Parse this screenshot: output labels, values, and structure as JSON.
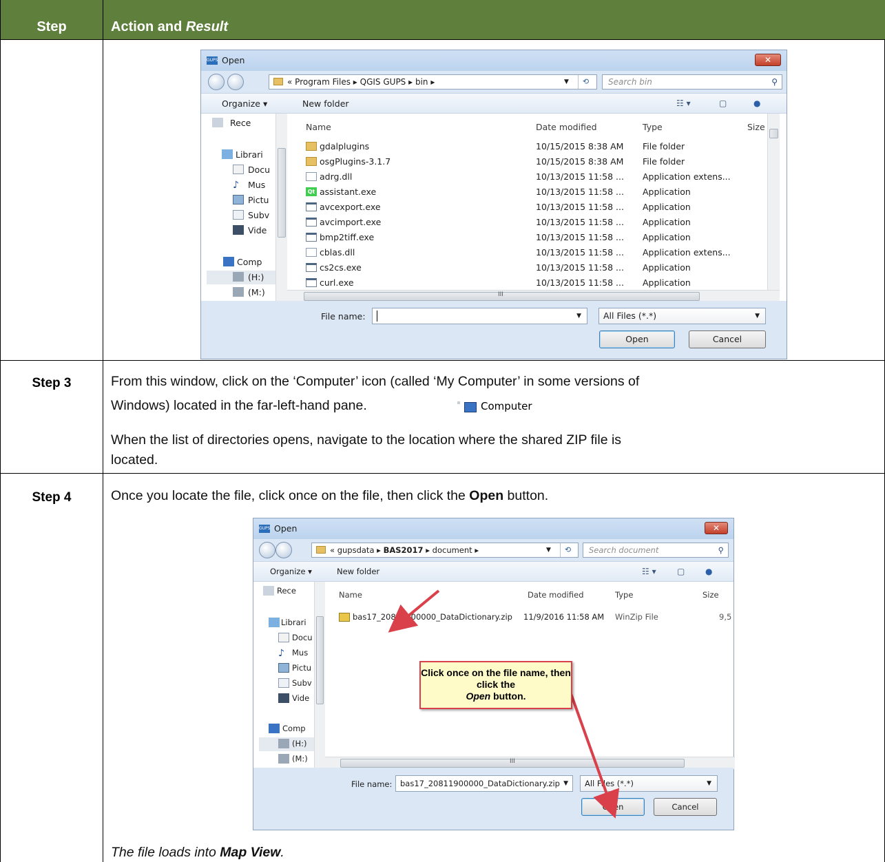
{
  "header": {
    "step_col": "Step",
    "action_col": "Action and ",
    "result_word": "Result"
  },
  "dialog1": {
    "title": "Open",
    "close_glyph": "✕",
    "address": {
      "chevrons": "«",
      "crumbs": [
        "Program Files",
        "QGIS GUPS",
        "bin"
      ],
      "separator": "▸"
    },
    "search_placeholder": "Search bin",
    "toolbar": {
      "organize": "Organize ▾",
      "new_folder": "New folder"
    },
    "sidebar": [
      "Rece",
      "Librari",
      "Docu",
      "Mus",
      "Pictu",
      "Subv",
      "Vide",
      "Comp",
      "(H:)",
      "(M:)"
    ],
    "columns": {
      "name": "Name",
      "date": "Date modified",
      "type": "Type",
      "size": "Size"
    },
    "files": [
      {
        "icon": "folder-icon",
        "name": "gdalplugins",
        "date": "10/15/2015 8:38 AM",
        "type": "File folder"
      },
      {
        "icon": "folder-icon",
        "name": "osgPlugins-3.1.7",
        "date": "10/15/2015 8:38 AM",
        "type": "File folder"
      },
      {
        "icon": "dll-icon",
        "name": "adrg.dll",
        "date": "10/13/2015 11:58 ...",
        "type": "Application extens..."
      },
      {
        "icon": "qt-icon",
        "name": "assistant.exe",
        "date": "10/13/2015 11:58 ...",
        "type": "Application"
      },
      {
        "icon": "exe-icon",
        "name": "avcexport.exe",
        "date": "10/13/2015 11:58 ...",
        "type": "Application"
      },
      {
        "icon": "exe-icon",
        "name": "avcimport.exe",
        "date": "10/13/2015 11:58 ...",
        "type": "Application"
      },
      {
        "icon": "exe-icon",
        "name": "bmp2tiff.exe",
        "date": "10/13/2015 11:58 ...",
        "type": "Application"
      },
      {
        "icon": "dll-icon",
        "name": "cblas.dll",
        "date": "10/13/2015 11:58 ...",
        "type": "Application extens..."
      },
      {
        "icon": "exe-icon",
        "name": "cs2cs.exe",
        "date": "10/13/2015 11:58 ...",
        "type": "Application"
      },
      {
        "icon": "exe-icon",
        "name": "curl.exe",
        "date": "10/13/2015 11:58 ...",
        "type": "Application"
      }
    ],
    "file_name_label": "File name:",
    "file_name_value": "",
    "filter": "All Files (*.*)",
    "open": "Open",
    "cancel": "Cancel",
    "hscroll_mark": "III"
  },
  "step3": {
    "label": "Step 3",
    "text1": "From this window, click on the ‘Computer’ icon (called ‘My Computer’ in some versions of",
    "text2": "Windows) located in the far-left-hand pane.",
    "computer_label": "Computer",
    "text3": "When the list of directories opens, navigate to the location where the shared ZIP file is",
    "text4": "located."
  },
  "step4": {
    "label": "Step 4",
    "text_a": "Once you locate the file, click once on the file, then click the ",
    "text_b": "Open",
    "text_c": " button.",
    "result_a": "The file loads into ",
    "result_b": "Map View",
    "result_c": "."
  },
  "dialog2": {
    "title": "Open",
    "close_glyph": "✕",
    "address": {
      "chevrons": "«",
      "crumbs": [
        "gupsdata",
        "BAS2017",
        "document"
      ],
      "separator": "▸"
    },
    "search_placeholder": "Search document",
    "toolbar": {
      "organize": "Organize ▾",
      "new_folder": "New folder"
    },
    "sidebar": [
      "Rece",
      "Librari",
      "Docu",
      "Mus",
      "Pictu",
      "Subv",
      "Vide",
      "Comp",
      "(H:)",
      "(M:)"
    ],
    "columns": {
      "name": "Name",
      "date": "Date modified",
      "type": "Type",
      "size": "Size"
    },
    "file": {
      "name": "bas17_20811900000_DataDictionary.zip",
      "date": "11/9/2016 11:58 AM",
      "type": "WinZip File",
      "size": "9,5"
    },
    "file_name_label": "File name:",
    "file_name_value": "bas17_20811900000_DataDictionary.zip",
    "filter": "All Files (*.*)",
    "open": "Open",
    "cancel": "Cancel",
    "hscroll_mark": "III",
    "callout_a": "Click once on the file name, then click the",
    "callout_b": "Open",
    "callout_c": " button."
  }
}
